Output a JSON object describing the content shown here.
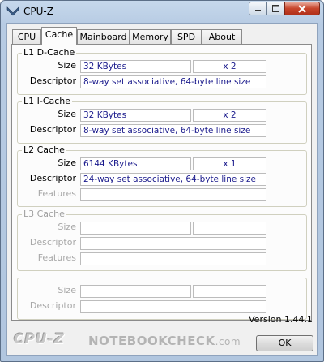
{
  "window": {
    "title": "CPU-Z"
  },
  "tabs": [
    {
      "label": "CPU"
    },
    {
      "label": "Cache"
    },
    {
      "label": "Mainboard"
    },
    {
      "label": "Memory"
    },
    {
      "label": "SPD"
    },
    {
      "label": "About"
    }
  ],
  "active_tab": "Cache",
  "l1d": {
    "title": "L1 D-Cache",
    "size_label": "Size",
    "size": "32 KBytes",
    "count": "x 2",
    "descriptor_label": "Descriptor",
    "descriptor": "8-way set associative, 64-byte line size"
  },
  "l1i": {
    "title": "L1 I-Cache",
    "size_label": "Size",
    "size": "32 KBytes",
    "count": "x 2",
    "descriptor_label": "Descriptor",
    "descriptor": "8-way set associative, 64-byte line size"
  },
  "l2": {
    "title": "L2 Cache",
    "size_label": "Size",
    "size": "6144 KBytes",
    "count": "x 1",
    "descriptor_label": "Descriptor",
    "descriptor": "24-way set associative, 64-byte line size",
    "features_label": "Features"
  },
  "l3": {
    "title": "L3 Cache",
    "size_label": "Size",
    "descriptor_label": "Descriptor",
    "features_label": "Features"
  },
  "extra": {
    "size_label": "Size",
    "descriptor_label": "Descriptor"
  },
  "version": "Version 1.44.1",
  "brand": "CPU-Z",
  "watermark": {
    "main": "NOTEBOOKCHECK",
    "suffix": ".com"
  },
  "ok_label": "OK",
  "icons": {
    "app": "cpu-z-chevron-icon",
    "minimize": "minimize-icon",
    "maximize": "maximize-icon",
    "close": "close-icon"
  }
}
